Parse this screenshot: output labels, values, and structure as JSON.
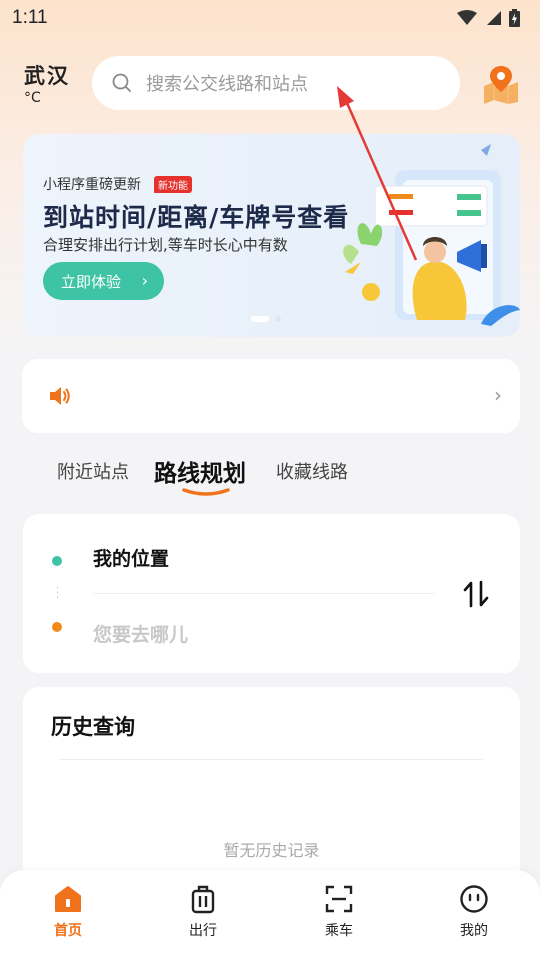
{
  "status_bar": {
    "time": "1:11"
  },
  "header": {
    "city": "武汉",
    "temperature": "°C",
    "search_placeholder": "搜索公交线路和站点"
  },
  "banner": {
    "subtitle": "小程序重磅更新",
    "tag": "新功能",
    "title": "到站时间/距离/车牌号查看",
    "description": "合理安排出行计划,等车时长心中有数",
    "button_label": "立即体验",
    "page_count": 2,
    "active_page": 1
  },
  "notice": {
    "text": ""
  },
  "tabs": [
    {
      "label": "附近站点",
      "active": false
    },
    {
      "label": "路线规划",
      "active": true
    },
    {
      "label": "收藏线路",
      "active": false
    }
  ],
  "route": {
    "from": "我的位置",
    "to_placeholder": "您要去哪儿"
  },
  "history": {
    "title": "历史查询",
    "empty_text": "暂无历史记录"
  },
  "bottom_nav": [
    {
      "label": "首页",
      "icon": "home-icon",
      "active": true
    },
    {
      "label": "出行",
      "icon": "luggage-icon",
      "active": false
    },
    {
      "label": "乘车",
      "icon": "scan-icon",
      "active": false
    },
    {
      "label": "我的",
      "icon": "profile-icon",
      "active": false
    }
  ],
  "colors": {
    "accent_orange": "#f0731b",
    "accent_green": "#3ec3a4",
    "tag_red": "#e5322d"
  }
}
